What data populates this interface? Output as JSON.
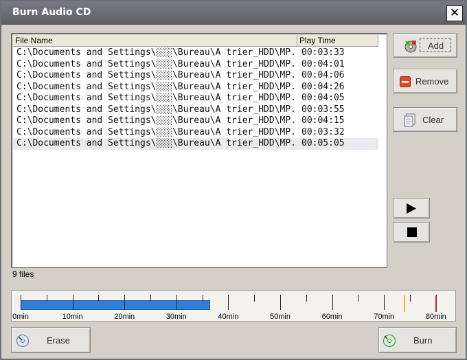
{
  "window": {
    "title": "Burn Audio CD",
    "close_label": "✕"
  },
  "list": {
    "columns": [
      "File Name",
      "Play Time"
    ],
    "rows": [
      {
        "name": "C:\\Documents and Settings\\░░░\\Bureau\\A trier_HDD\\MP...",
        "time": "00:03:33"
      },
      {
        "name": "C:\\Documents and Settings\\░░░\\Bureau\\A trier_HDD\\MP...",
        "time": "00:04:01"
      },
      {
        "name": "C:\\Documents and Settings\\░░░\\Bureau\\A trier_HDD\\MP...",
        "time": "00:04:06"
      },
      {
        "name": "C:\\Documents and Settings\\░░░\\Bureau\\A trier_HDD\\MP...",
        "time": "00:04:26"
      },
      {
        "name": "C:\\Documents and Settings\\░░░\\Bureau\\A trier_HDD\\MP...",
        "time": "00:04:05"
      },
      {
        "name": "C:\\Documents and Settings\\░░░\\Bureau\\A trier_HDD\\MP...",
        "time": "00:03:55"
      },
      {
        "name": "C:\\Documents and Settings\\░░░\\Bureau\\A trier_HDD\\MP...",
        "time": "00:04:15"
      },
      {
        "name": "C:\\Documents and Settings\\░░░\\Bureau\\A trier_HDD\\MP...",
        "time": "00:03:32"
      },
      {
        "name": "C:\\Documents and Settings\\░░░\\Bureau\\A trier_HDD\\MP...",
        "time": "00:05:05"
      }
    ],
    "selected_row": 8
  },
  "file_count": "9 files",
  "buttons": {
    "add": "Add",
    "remove": "Remove",
    "clear": "Clear",
    "erase": "Erase",
    "burn": "Burn"
  },
  "icons": {
    "add": "add-disc-icon",
    "remove": "remove-icon",
    "clear": "clear-document-icon",
    "play": "play-icon",
    "stop": "stop-icon",
    "erase": "erase-disc-icon",
    "burn": "burn-disc-icon"
  },
  "capacity": {
    "used_minutes": 36.5,
    "max_minutes": 84,
    "labels": [
      "0min",
      "10min",
      "20min",
      "30min",
      "40min",
      "50min",
      "60min",
      "70min",
      "80min"
    ],
    "markers": [
      {
        "minutes": 74,
        "color": "#e8b020"
      },
      {
        "minutes": 80,
        "color": "#cc2222"
      }
    ],
    "fill_color": "#2f7fd8"
  }
}
